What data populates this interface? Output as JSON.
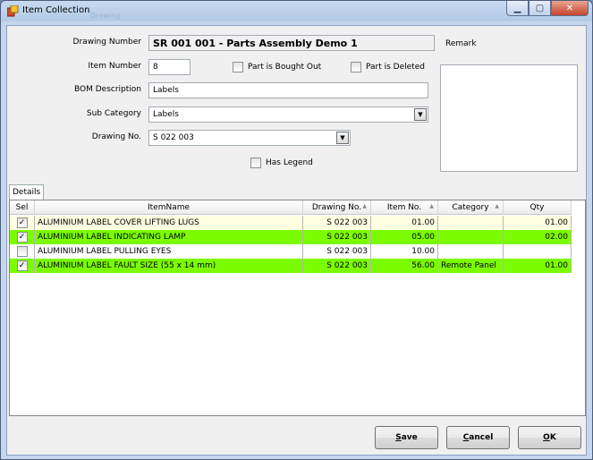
{
  "window": {
    "title": "Item Collection",
    "ghost_title": "Drawing"
  },
  "form": {
    "drawing_number_label": "Drawing Number",
    "drawing_number_value": "SR 001 001 - Parts Assembly Demo 1",
    "remark_label": "Remark",
    "item_number_label": "Item Number",
    "item_number_value": "8",
    "bought_out_label": "Part is Bought Out",
    "bought_out_checked": false,
    "deleted_label": "Part is Deleted",
    "deleted_checked": false,
    "bom_label": "BOM Description",
    "bom_value": "Labels",
    "subcat_label": "Sub Category",
    "subcat_value": "Labels",
    "drawing_no_label": "Drawing No.",
    "drawing_no_value": "S 022 003",
    "legend_label": "Has Legend",
    "legend_checked": false
  },
  "tabs": {
    "details": "Details"
  },
  "grid": {
    "columns": [
      "Sel",
      "ItemName",
      "Drawing No.",
      "Item No.",
      "Category",
      "Qty"
    ],
    "rows": [
      {
        "sel": true,
        "name": "ALUMINIUM LABEL COVER LIFTING LUGS",
        "drawing": "S 022 003",
        "item": "01.00",
        "category": "",
        "qty": "01.00",
        "color": "#ffffe1"
      },
      {
        "sel": true,
        "name": "ALUMINIUM LABEL INDICATING LAMP",
        "drawing": "S 022 003",
        "item": "05.00",
        "category": "",
        "qty": "02.00",
        "color": "#7cfc00"
      },
      {
        "sel": false,
        "name": "ALUMINIUM LABEL PULLING EYES",
        "drawing": "S 022 003",
        "item": "10.00",
        "category": "",
        "qty": "",
        "color": "#ffffff"
      },
      {
        "sel": true,
        "name": "ALUMINIUM LABEL FAULT SIZE (55 x 14 mm)",
        "drawing": "S 022 003",
        "item": "56.00",
        "category": "Remote Panel",
        "qty": "01.00",
        "color": "#7cfc00"
      }
    ]
  },
  "buttons": {
    "save_first": "S",
    "save_rest": "ave",
    "cancel_first": "C",
    "cancel_rest": "ancel",
    "ok_first": "O",
    "ok_rest": "K"
  },
  "colors": {
    "highlight_green": "#7cfc00",
    "first_row_yellow": "#ffffe1"
  }
}
